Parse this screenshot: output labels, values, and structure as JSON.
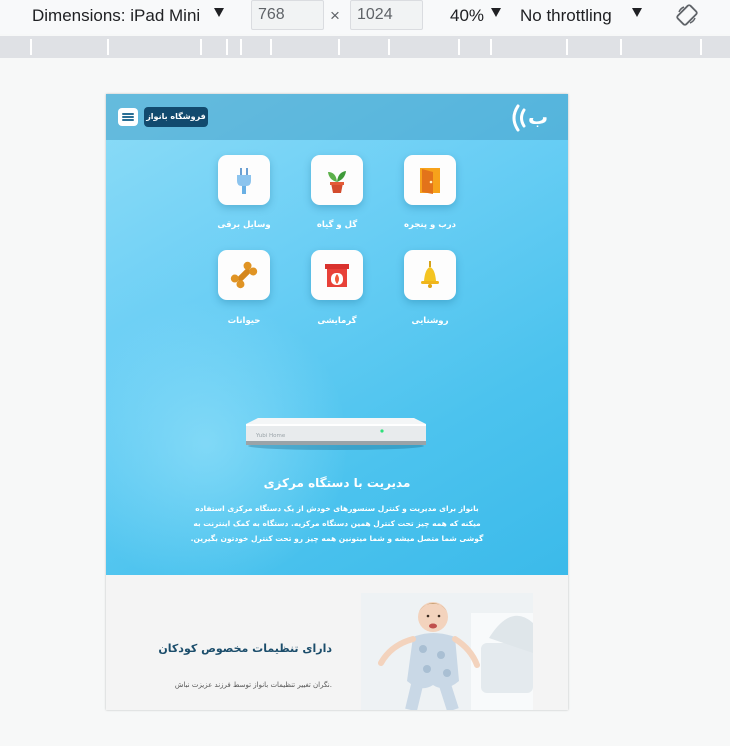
{
  "devtools": {
    "dimensions_label": "Dimensions: iPad Mini",
    "width_value": "768",
    "height_value": "1024",
    "times": "×",
    "zoom": "40%",
    "throttling": "No throttling"
  },
  "site": {
    "shop_button": "فروشگاه بانواز",
    "logo_text": "ب",
    "categories": [
      {
        "label": "درب و پنجره",
        "icon": "door-icon"
      },
      {
        "label": "گل و گیاه",
        "icon": "plant-icon"
      },
      {
        "label": "وسایل برقی",
        "icon": "plug-icon"
      },
      {
        "label": "روشنایی",
        "icon": "bell-lamp-icon"
      },
      {
        "label": "گرمایشی",
        "icon": "fireplace-icon"
      },
      {
        "label": "حیوانات",
        "icon": "bone-icon"
      }
    ],
    "hub_label": "Yubi Home",
    "hero_title": "مدیریت با دستگاه مرکزی",
    "hero_text": "بانواز برای مدیریت و کنترل سنسورهای خودش از یک دستگاه مرکزی استفاده میکنه که همه چیز تحت کنترل همین دستگاه مرکزیه. دستگاه به کمک اینترنت به گوشی شما متصل میشه و شما میتونین همه چیز رو تحت کنترل خودتون بگیرین.",
    "kids_title": "دارای تنظیمات مخصوص کودکان",
    "kids_text": "نگران تغییر تنظیمات بانواز توسط فرزند عزیزت نباش."
  },
  "colors": {
    "hero_light": "#8ddcf7",
    "hero_dark": "#3bbaea",
    "accent_dark_blue": "#124a6e"
  }
}
